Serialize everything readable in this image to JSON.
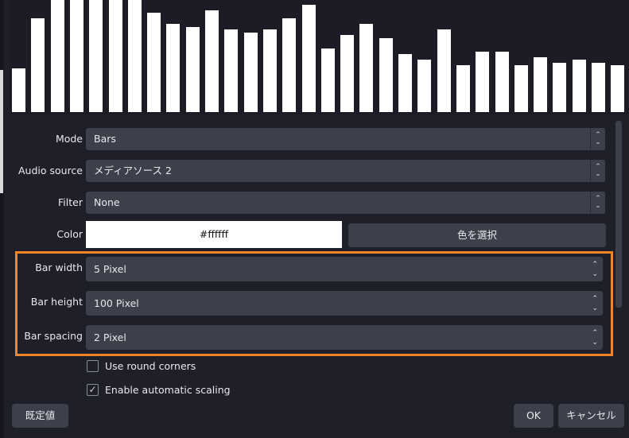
{
  "preview": {
    "bar_levels": [
      55,
      118,
      141,
      141,
      141,
      141,
      141,
      125,
      111,
      107,
      128,
      104,
      100,
      104,
      118,
      135,
      80,
      97,
      111,
      93,
      73,
      66,
      104,
      59,
      76,
      76,
      59,
      69,
      62,
      66,
      62,
      59
    ],
    "bar_color": "#ffffff"
  },
  "form": {
    "mode": {
      "label": "Mode",
      "value": "Bars"
    },
    "audio_source": {
      "label": "Audio source",
      "value": "メディアソース 2"
    },
    "filter": {
      "label": "Filter",
      "value": "None"
    },
    "color": {
      "label": "Color",
      "value": "#ffffff",
      "pick_button": "色を選択"
    },
    "bar_width": {
      "label": "Bar width",
      "value": "5 Pixel"
    },
    "bar_height": {
      "label": "Bar height",
      "value": "100 Pixel"
    },
    "bar_spacing": {
      "label": "Bar spacing",
      "value": "2 Pixel"
    },
    "round_corners": {
      "label": "Use round corners",
      "checked": false
    },
    "auto_scaling": {
      "label": "Enable automatic scaling",
      "checked": true
    }
  },
  "buttons": {
    "defaults": "既定値",
    "ok": "OK",
    "cancel": "キャンセル"
  },
  "icons": {
    "up": "⌃",
    "down": "⌄",
    "check": "✓"
  },
  "highlight_color": "#f58427"
}
